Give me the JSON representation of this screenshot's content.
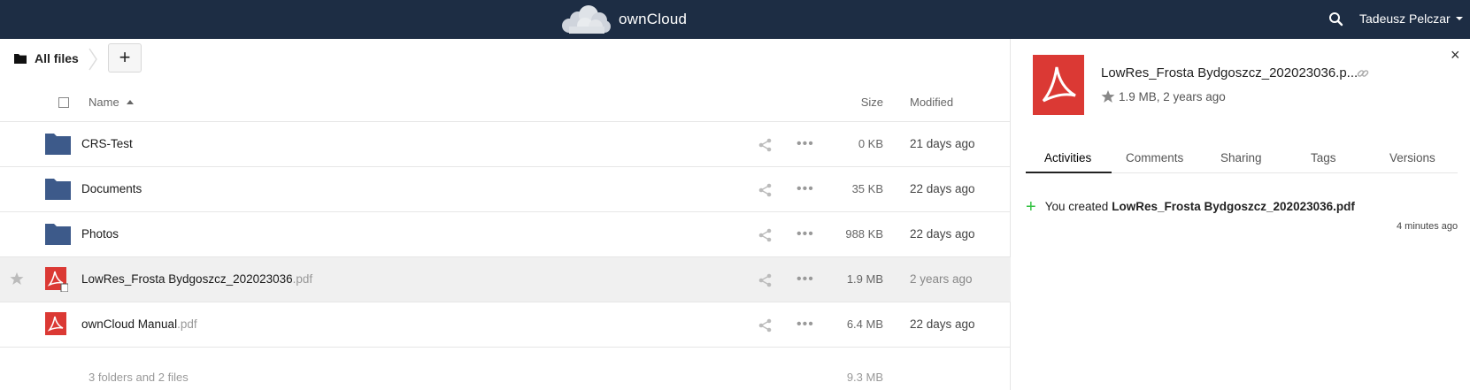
{
  "header": {
    "brand": "ownCloud",
    "user": "Tadeusz Pelczar"
  },
  "breadcrumb": {
    "home_label": "All files",
    "new_label": "+"
  },
  "table": {
    "columns": {
      "name": "Name",
      "size": "Size",
      "modified": "Modified"
    },
    "rows": [
      {
        "name": "CRS-Test",
        "ext": "",
        "type": "folder",
        "size": "0 KB",
        "modified": "21 days ago"
      },
      {
        "name": "Documents",
        "ext": "",
        "type": "folder",
        "size": "35 KB",
        "modified": "22 days ago"
      },
      {
        "name": "Photos",
        "ext": "",
        "type": "folder",
        "size": "988 KB",
        "modified": "22 days ago"
      },
      {
        "name": "LowRes_Frosta Bydgoszcz_202023036",
        "ext": ".pdf",
        "type": "pdf",
        "size": "1.9 MB",
        "modified": "2 years ago"
      },
      {
        "name": "ownCloud Manual",
        "ext": ".pdf",
        "type": "pdf",
        "size": "6.4 MB",
        "modified": "22 days ago"
      }
    ],
    "summary": {
      "count": "3 folders and 2 files",
      "total": "9.3 MB"
    }
  },
  "details": {
    "title": "LowRes_Frosta Bydgoszcz_202023036.p...",
    "meta": "1.9 MB, 2 years ago",
    "close": "×",
    "tabs": [
      "Activities",
      "Comments",
      "Sharing",
      "Tags",
      "Versions"
    ],
    "activity": {
      "prefix": "You created",
      "file": "LowRes_Frosta Bydgoszcz_202023036.pdf",
      "time": "4 minutes ago"
    }
  },
  "colors": {
    "header_bg": "#1d2d44",
    "folder": "#3d5a8a",
    "pdf": "#db3934",
    "plus": "#33c242"
  },
  "icons": [
    "owncloud-logo-icon",
    "search-icon",
    "folder-icon",
    "pdf-icon",
    "share-icon",
    "more-icon",
    "star-icon",
    "link-icon",
    "close-icon"
  ]
}
